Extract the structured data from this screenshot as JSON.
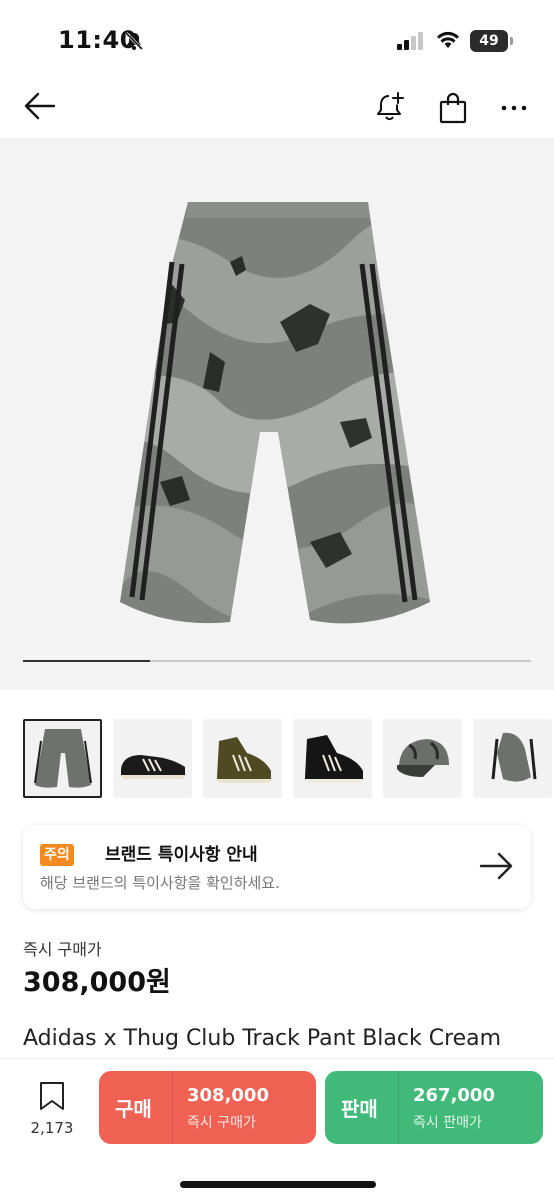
{
  "status_bar": {
    "time": "11:40",
    "battery": "49"
  },
  "carousel": {
    "progress": 0.25
  },
  "notice": {
    "badge": "주의",
    "title": "브랜드 특이사항 안내",
    "subtitle": "해당 브랜드의 특이사항을 확인하세요."
  },
  "price": {
    "label": "즉시 구매가",
    "value": "308,000원"
  },
  "product": {
    "name": "Adidas x Thug Club Track Pant Black Cream"
  },
  "bottom_bar": {
    "wish_count": "2,173",
    "buy": {
      "label": "구매",
      "amount": "308,000",
      "sub": "즉시 구매가"
    },
    "sell": {
      "label": "판매",
      "amount": "267,000",
      "sub": "즉시 판매가"
    }
  },
  "colors": {
    "buy": "#ef6253",
    "sell": "#41b979",
    "badge": "#f28a1f"
  }
}
